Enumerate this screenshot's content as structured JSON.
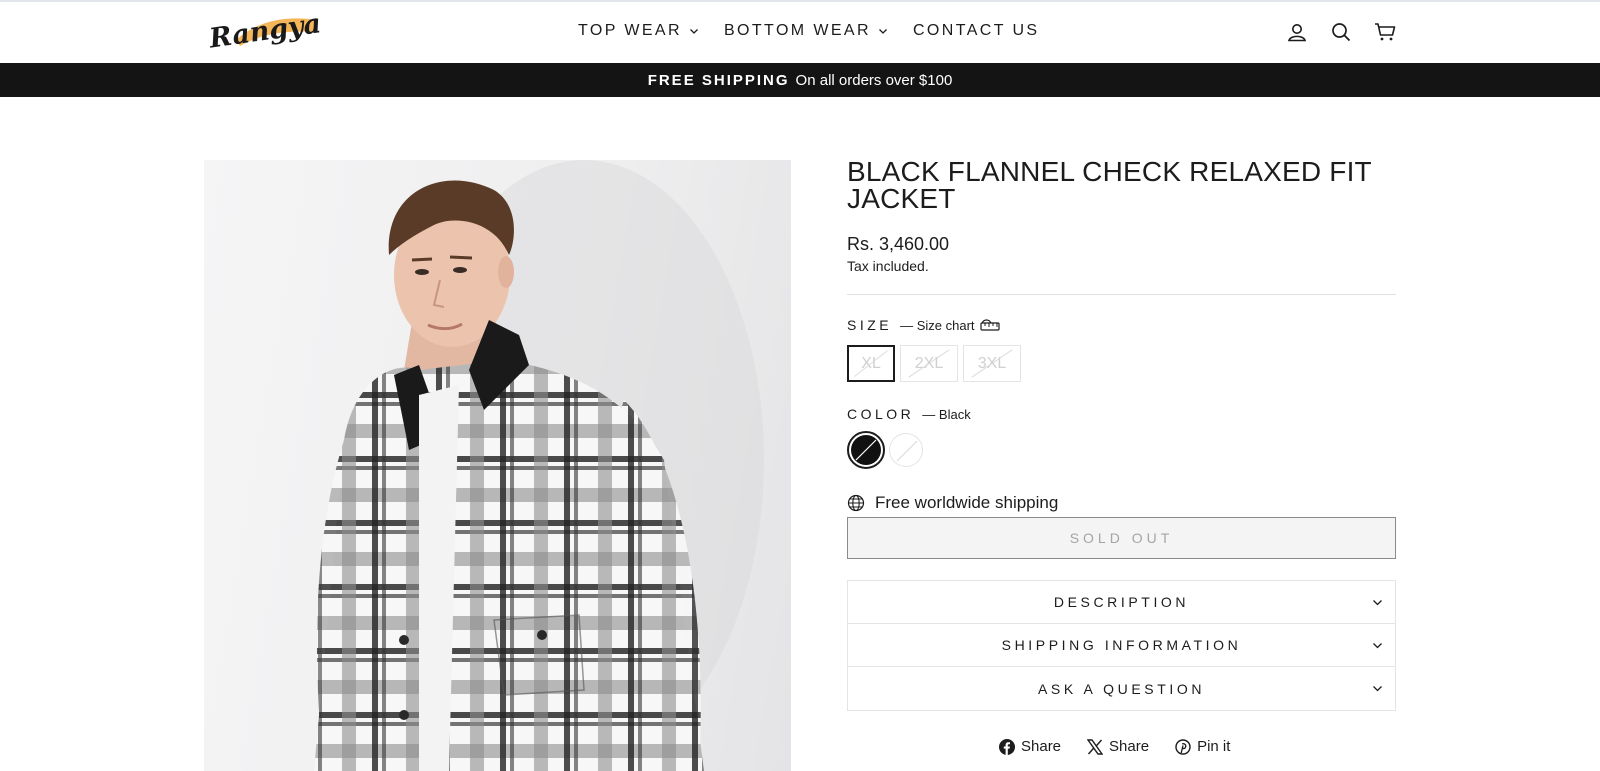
{
  "header": {
    "logo_text": "Rangya",
    "nav": [
      {
        "label": "TOP WEAR",
        "has_dropdown": true
      },
      {
        "label": "BOTTOM WEAR",
        "has_dropdown": true
      },
      {
        "label": "CONTACT US",
        "has_dropdown": false
      }
    ],
    "icons": [
      "account-icon",
      "search-icon",
      "cart-icon"
    ]
  },
  "announcement": {
    "strong": "FREE SHIPPING",
    "text": "On all orders over $100"
  },
  "product": {
    "title": "BLACK FLANNEL CHECK RELAXED FIT JACKET",
    "price": "Rs. 3,460.00",
    "tax_note": "Tax included.",
    "size": {
      "label": "SIZE",
      "size_chart": "— Size chart",
      "options": [
        "XL",
        "2XL",
        "3XL"
      ],
      "selected": "XL"
    },
    "color": {
      "label": "COLOR",
      "selected_name": "— Black",
      "options": [
        {
          "name": "Black",
          "hex": "#111111",
          "selected": true
        },
        {
          "name": "White",
          "hex": "#ffffff",
          "selected": false
        }
      ]
    },
    "shipping_note": "Free worldwide shipping",
    "sold_out_label": "SOLD OUT",
    "accordion": [
      "DESCRIPTION",
      "SHIPPING INFORMATION",
      "ASK A QUESTION"
    ],
    "share": [
      {
        "label": "Share",
        "icon": "facebook-icon"
      },
      {
        "label": "Share",
        "icon": "x-icon"
      },
      {
        "label": "Pin it",
        "icon": "pinterest-icon"
      }
    ]
  },
  "colors": {
    "announcement_bg": "#141414",
    "text": "#1c1c1c",
    "border": "#e4e4e4",
    "logo_brush": "#f2a93b"
  }
}
